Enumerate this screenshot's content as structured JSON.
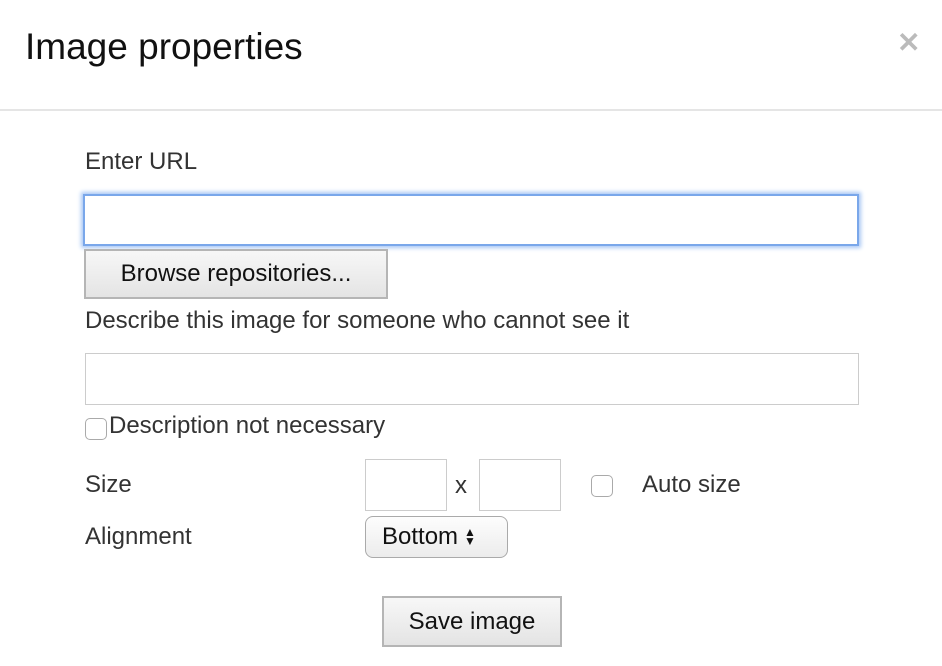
{
  "dialog": {
    "title": "Image properties",
    "close_icon": "close-icon"
  },
  "url": {
    "label": "Enter URL",
    "value": "",
    "placeholder": ""
  },
  "browse_label": "Browse repositories...",
  "alt": {
    "label": "Describe this image for someone who cannot see it",
    "value": ""
  },
  "desc_not_necessary": {
    "label": "Description not necessary",
    "checked": false
  },
  "size": {
    "label": "Size",
    "width": "",
    "height": "",
    "separator": "x",
    "auto_label": "Auto size",
    "auto_checked": false
  },
  "alignment": {
    "label": "Alignment",
    "selected": "Bottom"
  },
  "save_label": "Save image",
  "colors": {
    "focus": "#7aa7ea"
  }
}
